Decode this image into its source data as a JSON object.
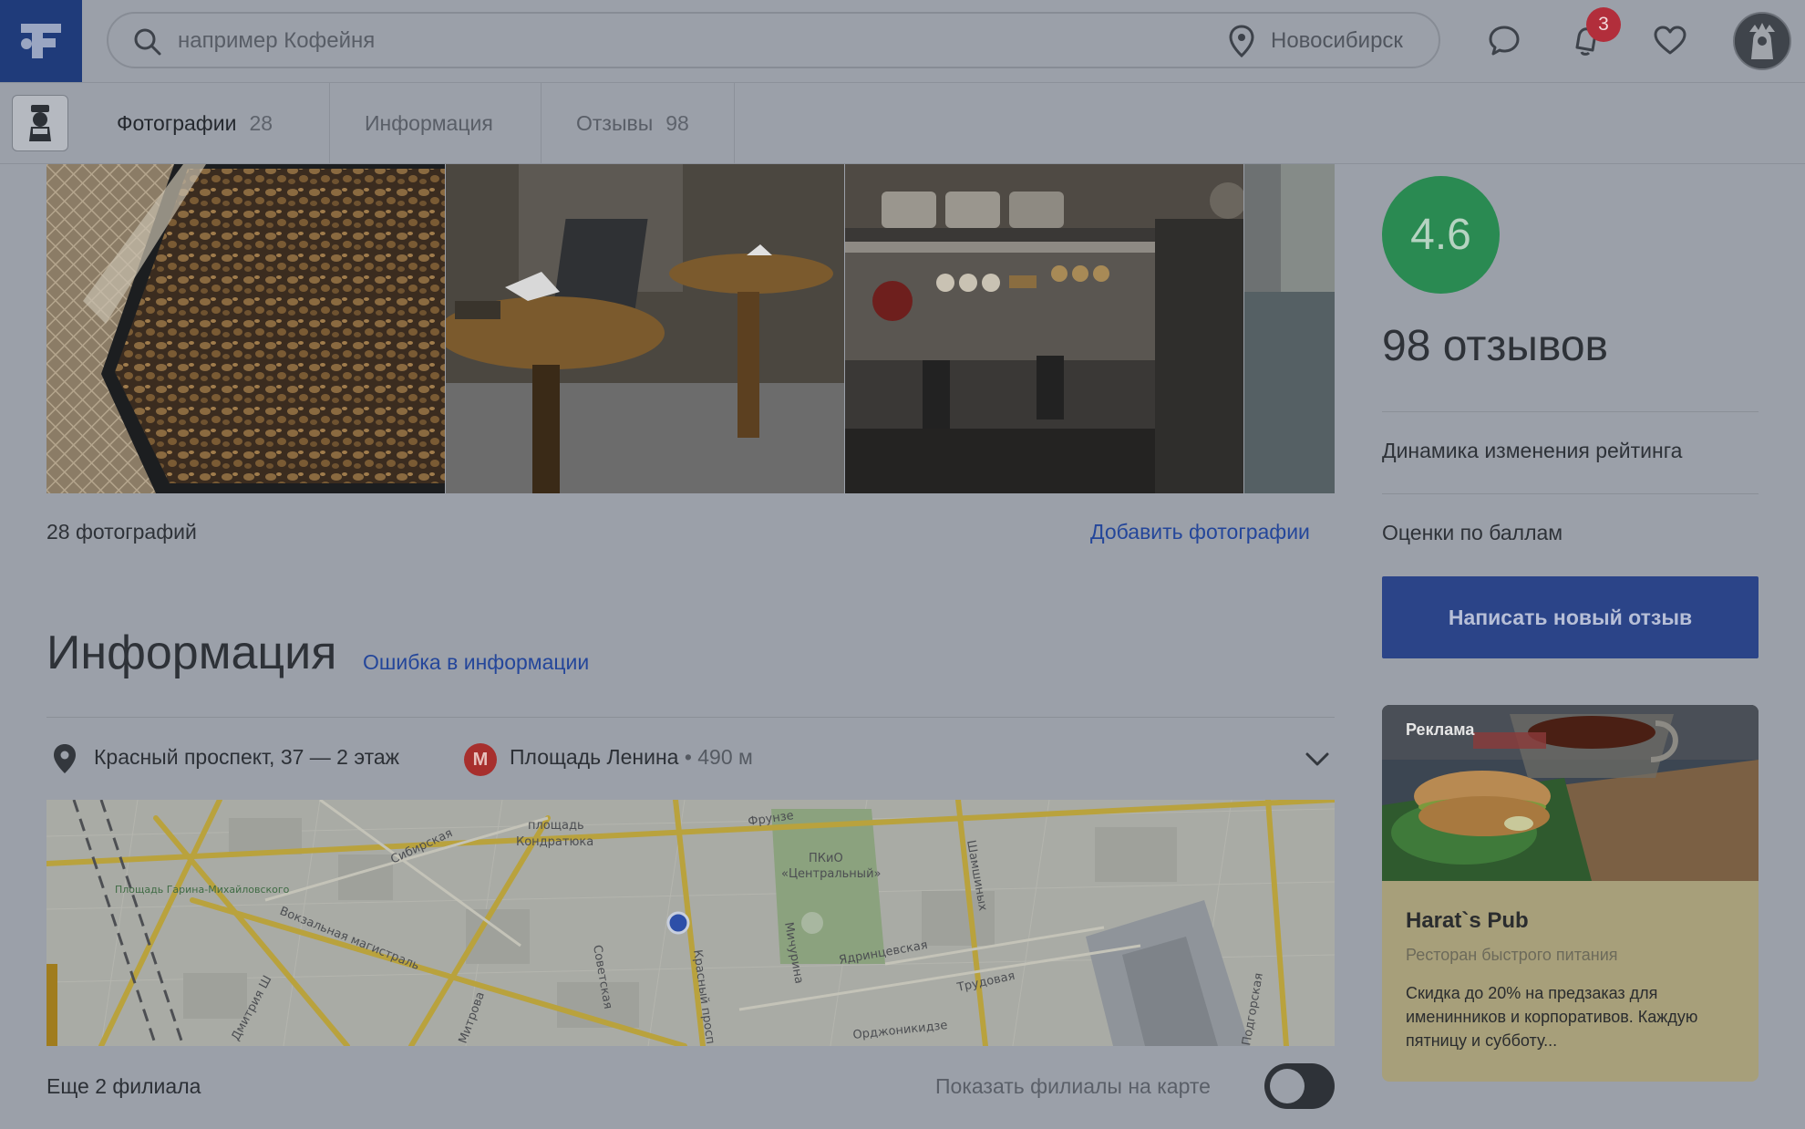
{
  "header": {
    "search_placeholder": "например Кофейня",
    "city": "Новосибирск",
    "notifications_count": "3"
  },
  "tabs": [
    {
      "label": "Фотографии",
      "count": "28"
    },
    {
      "label": "Информация",
      "count": ""
    },
    {
      "label": "Отзывы",
      "count": "98"
    }
  ],
  "photos": {
    "count_label": "28 фотографий",
    "add_label": "Добавить фотографии"
  },
  "info": {
    "title": "Информация",
    "error_link": "Ошибка в информации",
    "address": "Красный проспект, 37 — 2 этаж",
    "metro_letter": "М",
    "metro_station": "Площадь Ленина",
    "metro_distance": " • 490 м",
    "branches": "Еще 2 филиала",
    "show_on_map": "Показать филиалы на карте",
    "show_on_map_enabled": false
  },
  "map": {
    "labels": [
      "площадь Кондратюка",
      "Сибирская",
      "Фрунзе",
      "ПКиО «Центральный»",
      "Площадь Гарина-Михайловского",
      "Вокзальная магистраль",
      "Советская",
      "Красный просп",
      "Мичурина",
      "Ядринцевская",
      "Трудовая",
      "Орджоникидзе",
      "Дмитрия Ш",
      "Митрова",
      "Шамшиных",
      "Подгорская"
    ]
  },
  "rating": {
    "score": "4.6",
    "reviews_label": "98 отзывов",
    "dynamics_link": "Динамика изменения рейтинга",
    "scores_link": "Оценки по баллам",
    "write_button": "Написать новый отзыв"
  },
  "ad": {
    "tag": "Реклама",
    "name": "Harat`s Pub",
    "category": "Ресторан быстрого питания",
    "description": "Скидка до 20% на предзаказ для именинников и корпоративов. Каждую пятницу и субботу..."
  },
  "colors": {
    "accent": "#2b4488",
    "link": "#24469a",
    "score_green": "#2a8a52",
    "badge_red": "#b22e3b"
  }
}
